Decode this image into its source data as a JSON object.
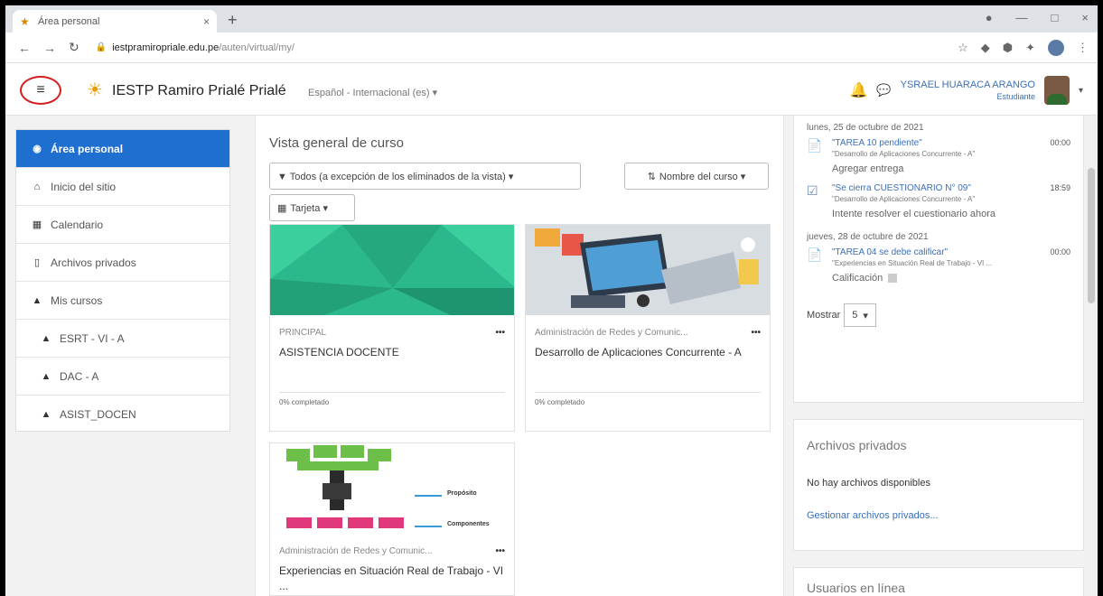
{
  "browser": {
    "tab_title": "Área personal",
    "url_host": "iestpramiropriale.edu.pe",
    "url_path": "/auten/virtual/my/"
  },
  "header": {
    "site_name": "IESTP Ramiro Prialé Prialé",
    "language": "Español - Internacional (es) ▾",
    "user_name": "YSRAEL HUARACA ARANGO",
    "user_role": "Estudiante"
  },
  "sidebar": {
    "items": [
      {
        "label": "Área personal",
        "icon": "tachometer-icon"
      },
      {
        "label": "Inicio del sitio",
        "icon": "home-icon"
      },
      {
        "label": "Calendario",
        "icon": "calendar-icon"
      },
      {
        "label": "Archivos privados",
        "icon": "file-icon"
      },
      {
        "label": "Mis cursos",
        "icon": "graduation-cap-icon"
      },
      {
        "label": "ESRT - VI - A",
        "icon": "graduation-cap-icon"
      },
      {
        "label": "DAC - A",
        "icon": "graduation-cap-icon"
      },
      {
        "label": "ASIST_DOCEN",
        "icon": "graduation-cap-icon"
      }
    ]
  },
  "course_overview": {
    "title": "Vista general de curso",
    "filter_label": "▼ Todos (a excepción de los eliminados de la vista) ▾",
    "sort_label": "Nombre del curso ▾",
    "view_label": "Tarjeta ▾",
    "courses": [
      {
        "category": "PRINCIPAL",
        "name": "ASISTENCIA DOCENTE",
        "progress": "0% completado"
      },
      {
        "category": "Administración de Redes y Comunic...",
        "name": "Desarrollo de Aplicaciones Concurrente - A",
        "progress": "0% completado"
      },
      {
        "category": "Administración de Redes y Comunic...",
        "name": "Experiencias en Situación Real de Trabajo - VI ...",
        "progress": ""
      }
    ],
    "tree_labels": {
      "a": "Propósito",
      "b": "Componentes"
    }
  },
  "timeline": {
    "day1": "lunes, 25 de octubre de 2021",
    "ev1": {
      "title": "\"TAREA 10 pendiente\"",
      "time": "00:00",
      "course": "\"Desarrollo de Aplicaciones Concurrente - A\"",
      "action": "Agregar entrega"
    },
    "ev2": {
      "title": "\"Se cierra CUESTIONARIO N° 09\"",
      "time": "18:59",
      "course": "\"Desarrollo de Aplicaciones Concurrente - A\"",
      "action": "Intente resolver el cuestionario ahora"
    },
    "day2": "jueves, 28 de octubre de 2021",
    "ev3": {
      "title": "\"TAREA 04 se debe calificar\"",
      "time": "00:00",
      "course": "\"Experiencias en Situación Real de Trabajo - VI ...",
      "action": "Calificación"
    },
    "show_label": "Mostrar",
    "show_value": "5"
  },
  "private_files": {
    "title": "Archivos privados",
    "empty": "No hay archivos disponibles",
    "manage": "Gestionar archivos privados..."
  },
  "online_users": {
    "title": "Usuarios en línea"
  },
  "colors": {
    "accent": "#1f6fd1",
    "highlight": "#d21f1f"
  }
}
